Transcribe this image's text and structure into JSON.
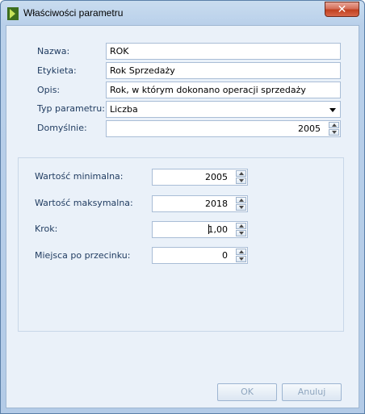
{
  "window": {
    "title": "Właściwości parametru",
    "close_glyph": "✕"
  },
  "form": {
    "name_label": "Nazwa:",
    "name_value": "ROK",
    "label_label": "Etykieta:",
    "label_value": "Rok Sprzedaży",
    "description_label": "Opis:",
    "description_value": "Rok, w którym dokonano operacji sprzedaży",
    "type_label": "Typ parametru:",
    "type_value": "Liczba",
    "default_label": "Domyślnie:",
    "default_value": "2005"
  },
  "number_settings": {
    "min_label": "Wartość minimalna:",
    "min_value": "2005",
    "max_label": "Wartość maksymalna:",
    "max_value": "2018",
    "step_label": "Krok:",
    "step_value": "1,00",
    "decimals_label": "Miejsca po przecinku:",
    "decimals_value": "0"
  },
  "buttons": {
    "ok": "OK",
    "cancel": "Anuluj"
  },
  "colors": {
    "close_button": "#c0401f",
    "window_frame": "#b9d0ea",
    "client_bg": "#eaf1f9"
  },
  "icons": {
    "app": "app-logo-icon",
    "close": "close-icon",
    "spin": "spin-arrows-icon",
    "dropdown": "chevron-down-icon"
  }
}
